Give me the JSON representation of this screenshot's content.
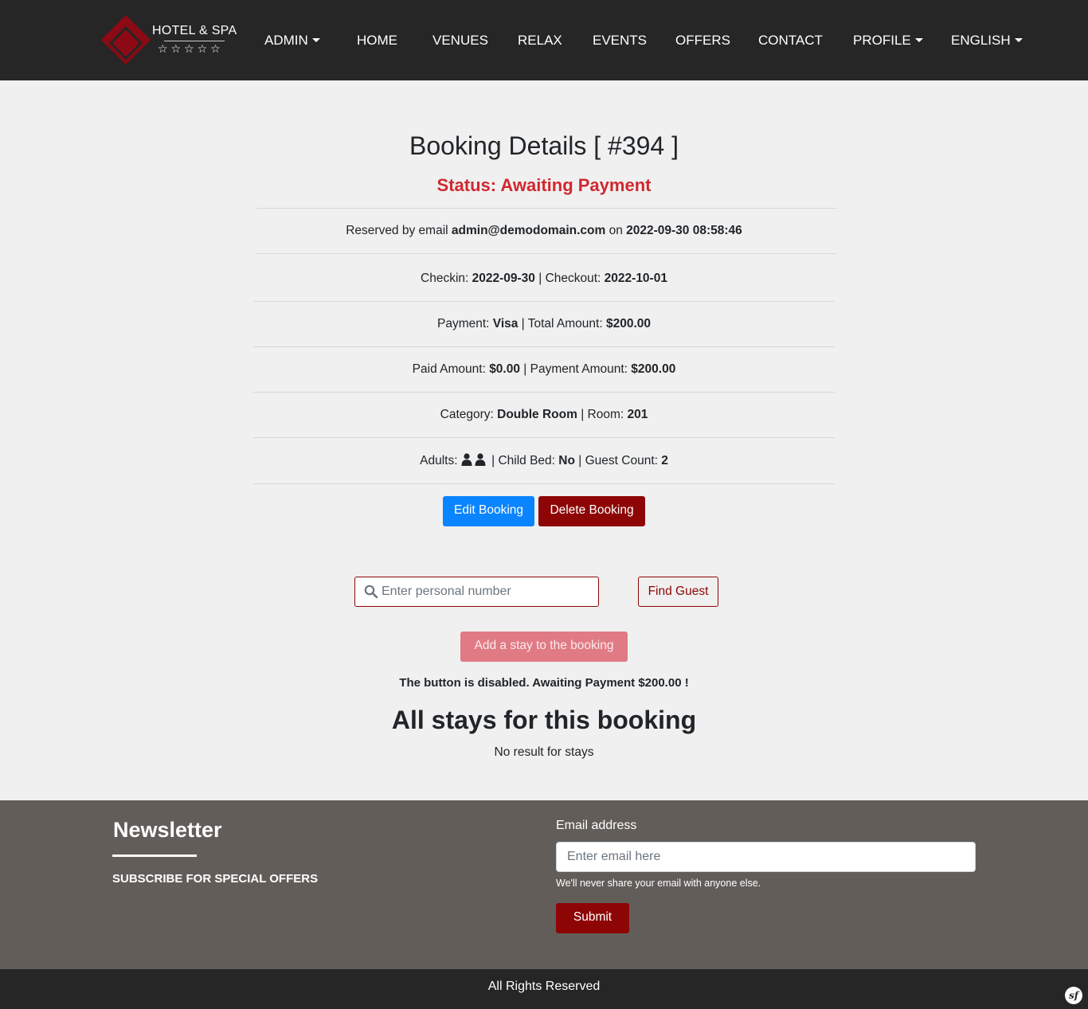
{
  "navbar": {
    "logo": {
      "text": "HOTEL & SPA",
      "stars": "☆☆☆☆☆"
    },
    "items": [
      {
        "label": "ADMIN",
        "dropdown": true
      },
      {
        "label": "HOME"
      },
      {
        "label": "VENUES"
      },
      {
        "label": "RELAX"
      },
      {
        "label": "EVENTS"
      },
      {
        "label": "OFFERS"
      },
      {
        "label": "CONTACT"
      },
      {
        "label": "PROFILE",
        "dropdown": true
      },
      {
        "label": "ENGLISH",
        "dropdown": true
      }
    ]
  },
  "booking": {
    "title": "Booking Details [ #394 ]",
    "status": "Status: Awaiting Payment",
    "reserved_prefix": "Reserved by email ",
    "email": "admin@demodomain.com",
    "on": " on ",
    "reserved_at": "2022-09-30 08:58:46",
    "checkin_label": "Checkin: ",
    "checkin": "2022-09-30",
    "checkout_label": " | Checkout: ",
    "checkout": "2022-10-01",
    "payment_label": "Payment: ",
    "payment": "Visa",
    "total_label": " | Total Amount: ",
    "total": "$200.00",
    "paid_label": "Paid Amount: ",
    "paid": "$0.00",
    "payment_amount_label": " | Payment Amount: ",
    "payment_amount": "$200.00",
    "category_label": "Category: ",
    "category": "Double Room",
    "room_label": " | Room: ",
    "room": "201",
    "adults_label": "Adults: ",
    "adults_count": 2,
    "child_bed_label": " | Child Bed: ",
    "child_bed": "No",
    "guest_count_label": " | Guest Count: ",
    "guest_count": "2",
    "edit_label": "Edit Booking",
    "delete_label": "Delete Booking"
  },
  "guest_search": {
    "placeholder": "Enter personal number",
    "find_label": "Find Guest"
  },
  "stays": {
    "add_label": "Add a stay to the booking",
    "disabled_note": "The button is disabled. Awaiting Payment $200.00 !",
    "title": "All stays for this booking",
    "empty": "No result for stays"
  },
  "footer": {
    "newsletter_title": "Newsletter",
    "subscribe": "SUBSCRIBE FOR SPECIAL OFFERS",
    "email_label": "Email address",
    "email_placeholder": "Enter email here",
    "email_help": "We'll never share your email with anyone else.",
    "submit_label": "Submit",
    "rights": "All Rights Reserved",
    "sf_badge": "sf"
  },
  "colors": {
    "navbar_bg": "#262626",
    "status_red": "#d0282f",
    "edit_blue": "#0a84ff",
    "brand_dark_red": "#8e0505",
    "disabled_pink": "#e07b85",
    "footer_bg": "#625d59"
  }
}
